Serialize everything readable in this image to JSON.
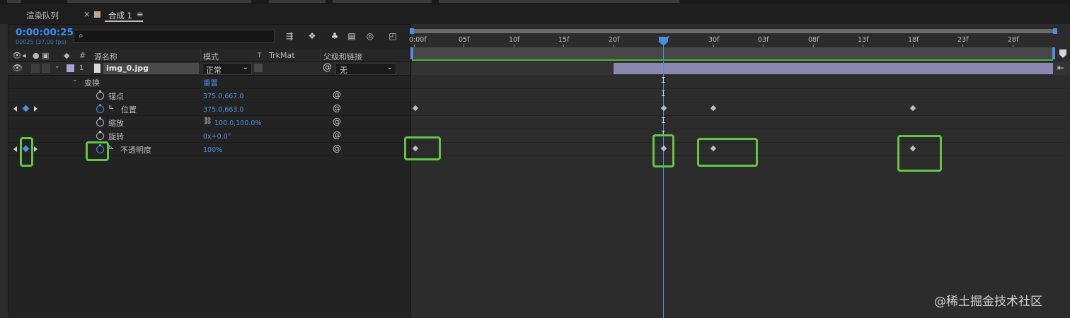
{
  "tabs": [
    {
      "label": "渲染队列"
    },
    {
      "label": "合成 1"
    }
  ],
  "timecode": "0:00:00:25",
  "fps_line": "00025 (37.00 fps)",
  "columns": {
    "source_name": "源名称",
    "mode": "模式",
    "t": "T",
    "trkmat": "TrkMat",
    "parent": "父级和链接",
    "number_sign": "#"
  },
  "layer": {
    "index": "1",
    "name": "img_0.jpg",
    "mode": "正常",
    "parent": "无"
  },
  "transform": {
    "label": "变换",
    "reset": "重置"
  },
  "properties": [
    {
      "name": "锚点",
      "value": "375.0,667.0"
    },
    {
      "name": "位置",
      "value": "375.0,663.0"
    },
    {
      "name": "缩放",
      "value": "100.0,100.0%"
    },
    {
      "name": "旋转",
      "value": "0x+0.0°"
    },
    {
      "name": "不透明度",
      "value": "100%"
    }
  ],
  "ruler_ticks": [
    "0:00f",
    "05f",
    "10f",
    "15f",
    "20f",
    "25f",
    "30f",
    "03f",
    "08f",
    "13f",
    "18f",
    "23f",
    "28f"
  ],
  "watermark": "@稀土掘金技术社区",
  "colors": {
    "accent": "#3a8df0",
    "highlight_box": "#62c544",
    "layer_bar": "#8a87b0"
  }
}
